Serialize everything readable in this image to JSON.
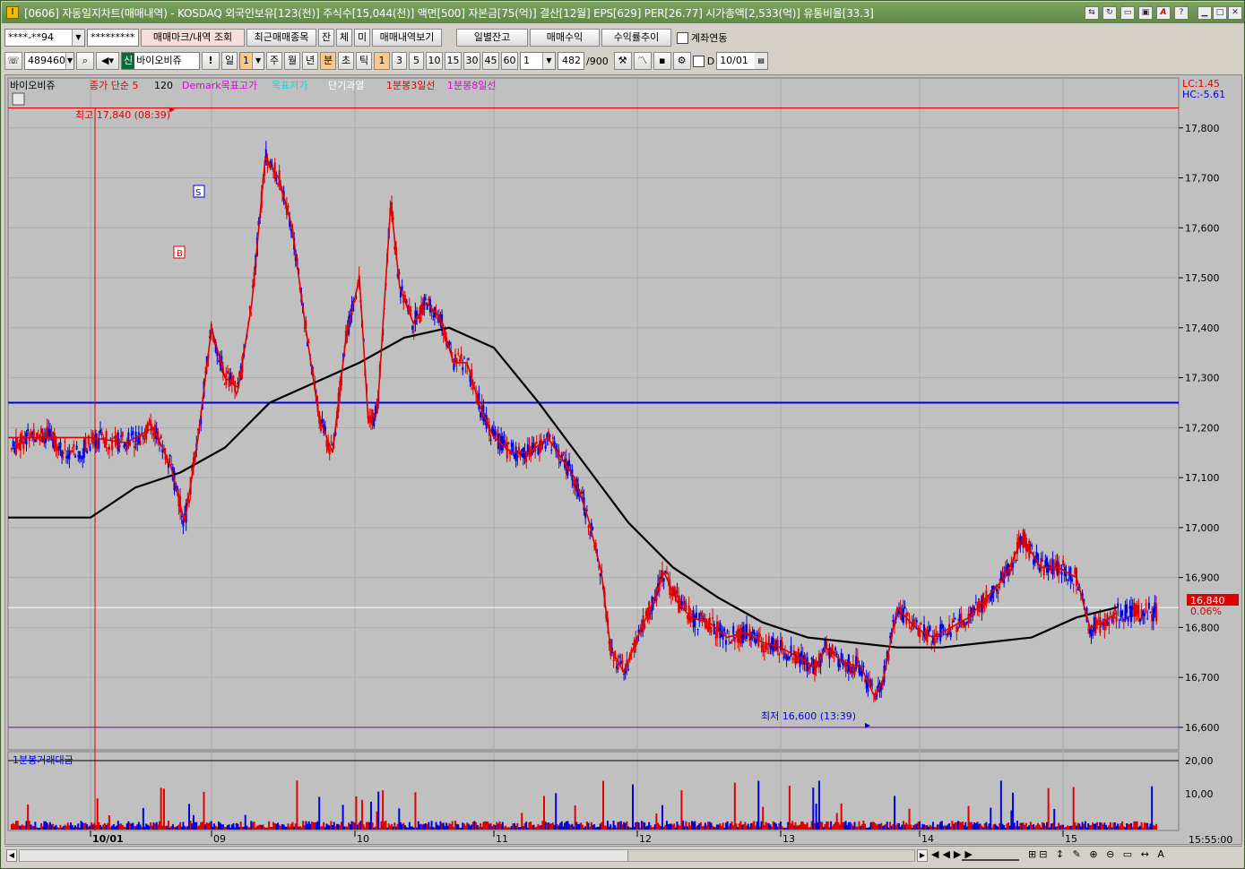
{
  "window": {
    "title": "[0606] 자동일지차트(매매내역) - KOSDAQ 외국인보유[123(천)] 주식수[15,044(천)] 액면[500] 자본금[75(억)] 결산[12월] EPS[629] PER[26.77] 시가총액[2,533(억)] 유통비율[33.3]"
  },
  "toolbar1": {
    "account": "****-**94",
    "password": "*********",
    "btn_mark": "매매마크/내역 조회",
    "btn_recent": "최근매매종목",
    "btn_jan": "잔",
    "btn_che": "체",
    "btn_mi": "미",
    "btn_history": "매매내역보기",
    "btn_daily": "일별잔고",
    "btn_profit": "매매수익",
    "btn_trend": "수익률추이",
    "chk_link": "계좌연동"
  },
  "toolbar2": {
    "code": "489460",
    "stock_badge": "신",
    "stock_name": "바이오비쥬",
    "exclaim": "!",
    "period_il": "일",
    "period_val": "1",
    "p_ju": "주",
    "p_wol": "월",
    "p_nyeon": "년",
    "p_bun": "분",
    "p_cho": "초",
    "p_tik": "틱",
    "m1": "1",
    "m3": "3",
    "m5": "5",
    "m10": "10",
    "m15": "15",
    "m30": "30",
    "m45": "45",
    "m60": "60",
    "count": "1",
    "range": "482",
    "range_total": "/900",
    "d_label": "D",
    "date": "10/01"
  },
  "legend": {
    "stock": "바이오비쥬",
    "price": "종가 단순 5",
    "n120": "120",
    "demark": "Demark목표고가",
    "target": "목표저가",
    "short": "단기과열",
    "ma3": "1분봉3일선",
    "ma8": "1분봉8일선",
    "lc": "LC:1.45",
    "hc": "HC:-5.61"
  },
  "volume_legend": "1분봉거래대금",
  "annotations": {
    "high": "최고 17,840 (08:39)",
    "low": "최저 16,600 (13:39)",
    "buy": "B",
    "sell": "S"
  },
  "current": {
    "price": "16,840",
    "pct": "0.06%"
  },
  "time_readout": "15:55:00",
  "chart_data": {
    "type": "line",
    "x_labels": [
      "10/01",
      "09",
      "10",
      "11",
      "12",
      "13",
      "14",
      "15"
    ],
    "y_ticks": [
      17800,
      17700,
      17600,
      17500,
      17400,
      17300,
      17200,
      17100,
      17000,
      16900,
      16800,
      16700,
      16600
    ],
    "y_tick_labels": [
      "17,800",
      "17,700",
      "17,600",
      "17,500",
      "17,400",
      "17,300",
      "17,200",
      "17,100",
      "17,000",
      "16,900",
      "16,800",
      "16,700",
      "16,600"
    ],
    "ylim": [
      16555,
      17900
    ],
    "high": 17840,
    "low": 16600,
    "reference_line": 17250,
    "current": 16840,
    "close_line": [
      [
        0,
        17180
      ],
      [
        0.04,
        17170
      ],
      [
        0.07,
        17200
      ],
      [
        0.09,
        17120
      ],
      [
        0.105,
        17010
      ],
      [
        0.12,
        17180
      ],
      [
        0.135,
        17400
      ],
      [
        0.15,
        17300
      ],
      [
        0.165,
        17280
      ],
      [
        0.18,
        17450
      ],
      [
        0.195,
        17740
      ],
      [
        0.21,
        17700
      ],
      [
        0.225,
        17600
      ],
      [
        0.24,
        17400
      ],
      [
        0.255,
        17220
      ],
      [
        0.27,
        17150
      ],
      [
        0.285,
        17380
      ],
      [
        0.3,
        17500
      ],
      [
        0.31,
        17210
      ],
      [
        0.32,
        17230
      ],
      [
        0.335,
        17650
      ],
      [
        0.345,
        17480
      ],
      [
        0.36,
        17410
      ],
      [
        0.375,
        17450
      ],
      [
        0.39,
        17420
      ],
      [
        0.405,
        17330
      ],
      [
        0.42,
        17330
      ],
      [
        0.435,
        17240
      ],
      [
        0.45,
        17180
      ],
      [
        0.47,
        17150
      ],
      [
        0.49,
        17150
      ],
      [
        0.51,
        17180
      ],
      [
        0.525,
        17140
      ],
      [
        0.54,
        17100
      ],
      [
        0.555,
        17020
      ],
      [
        0.57,
        16910
      ],
      [
        0.58,
        16760
      ],
      [
        0.595,
        16710
      ],
      [
        0.61,
        16780
      ],
      [
        0.625,
        16840
      ],
      [
        0.64,
        16910
      ],
      [
        0.655,
        16850
      ],
      [
        0.67,
        16820
      ],
      [
        0.69,
        16810
      ],
      [
        0.71,
        16780
      ],
      [
        0.73,
        16790
      ],
      [
        0.75,
        16770
      ],
      [
        0.77,
        16760
      ],
      [
        0.79,
        16740
      ],
      [
        0.81,
        16720
      ],
      [
        0.82,
        16760
      ],
      [
        0.84,
        16730
      ],
      [
        0.86,
        16720
      ],
      [
        0.875,
        16660
      ],
      [
        0.885,
        16700
      ],
      [
        0.9,
        16840
      ],
      [
        0.92,
        16800
      ],
      [
        0.94,
        16780
      ],
      [
        0.96,
        16800
      ],
      [
        0.98,
        16820
      ],
      [
        1,
        16860
      ],
      [
        1.02,
        16900
      ],
      [
        1.04,
        16980
      ],
      [
        1.06,
        16920
      ],
      [
        1.08,
        16920
      ],
      [
        1.1,
        16900
      ],
      [
        1.115,
        16800
      ],
      [
        1.13,
        16810
      ],
      [
        1.145,
        16830
      ]
    ],
    "ma120": [
      [
        0,
        17020
      ],
      [
        0.05,
        17080
      ],
      [
        0.1,
        17110
      ],
      [
        0.15,
        17160
      ],
      [
        0.2,
        17250
      ],
      [
        0.25,
        17290
      ],
      [
        0.3,
        17330
      ],
      [
        0.35,
        17380
      ],
      [
        0.4,
        17400
      ],
      [
        0.45,
        17360
      ],
      [
        0.5,
        17250
      ],
      [
        0.55,
        17130
      ],
      [
        0.6,
        17010
      ],
      [
        0.65,
        16920
      ],
      [
        0.7,
        16860
      ],
      [
        0.75,
        16810
      ],
      [
        0.8,
        16780
      ],
      [
        0.85,
        16770
      ],
      [
        0.9,
        16760
      ],
      [
        0.95,
        16760
      ],
      [
        1,
        16770
      ],
      [
        1.05,
        16780
      ],
      [
        1.1,
        16820
      ],
      [
        1.145,
        16840
      ]
    ],
    "volume_ticks": [
      "20,00",
      "10,00"
    ]
  }
}
